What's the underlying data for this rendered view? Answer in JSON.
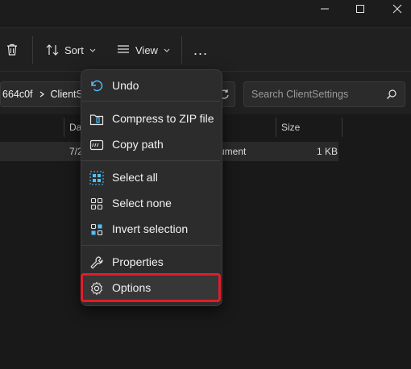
{
  "toolbar": {
    "sort_label": "Sort",
    "view_label": "View",
    "more_label": "..."
  },
  "address": {
    "path_segment_1": "664c0f",
    "path_segment_2": "ClientSe"
  },
  "search": {
    "placeholder": "Search ClientSettings"
  },
  "columns": {
    "date_partial": "Da",
    "size": "Size"
  },
  "file_row": {
    "date_partial": "7/2",
    "type_partial": "ument",
    "size": "1 KB"
  },
  "context_menu": {
    "undo": "Undo",
    "compress": "Compress to ZIP file",
    "copy_path": "Copy path",
    "select_all": "Select all",
    "select_none": "Select none",
    "invert_selection": "Invert selection",
    "properties": "Properties",
    "options": "Options"
  },
  "colors": {
    "accent": "#4cc2ff",
    "highlight_border": "#e11d2b",
    "menu_bg": "#2c2c2c"
  }
}
